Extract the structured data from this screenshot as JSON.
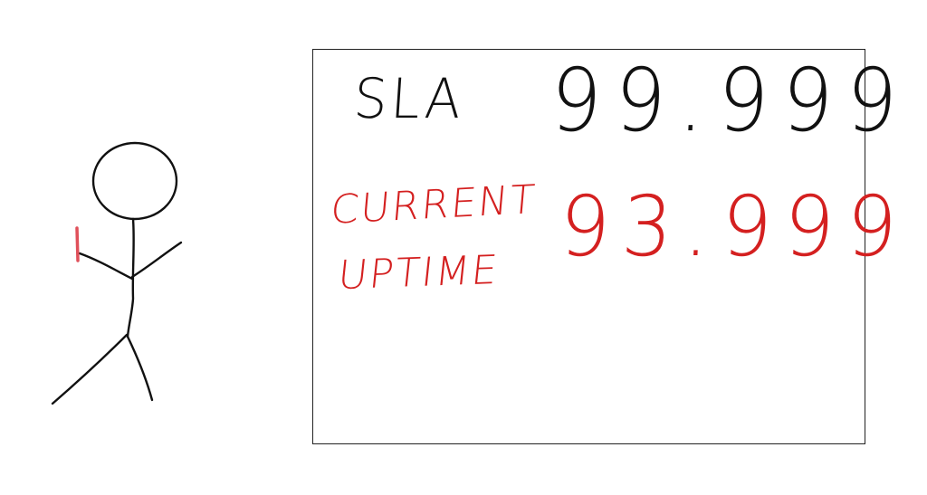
{
  "board": {
    "sla_label": "SLA",
    "sla_value": "99.999",
    "current_label_line1": "CURRENT",
    "current_label_line2": "UPTIME",
    "current_value": "93.999"
  },
  "colors": {
    "ink": "#111111",
    "accent_red": "#d42020",
    "pencil_red": "#e0505a"
  },
  "icons": {
    "figure": "stick-figure-icon"
  }
}
